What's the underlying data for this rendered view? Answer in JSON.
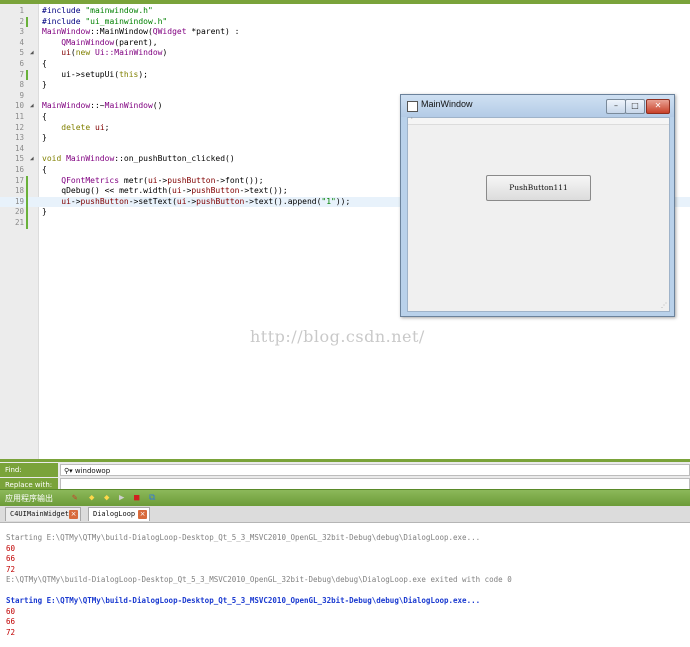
{
  "header": {
    "watermark_text": "http://blog.csdn.net/"
  },
  "editor": {
    "lines": [
      {
        "n": "1",
        "html": "<span class='pp'>#include</span> <span class='str'>\"mainwindow.h\"</span>"
      },
      {
        "n": "2",
        "html": "<span class='pp'>#include</span> <span class='str'>\"ui_mainwindow.h\"</span>",
        "mod": true
      },
      {
        "n": "3",
        "html": "<span class='cls'>MainWindow</span>::MainWindow(<span class='cls'>QWidget</span> *parent) :"
      },
      {
        "n": "4",
        "html": "    <span class='cls'>QMainWindow</span>(parent),"
      },
      {
        "n": "5",
        "html": "    <span class='mem'>ui</span>(<span class='kw'>new</span> <span class='cls'>Ui::MainWindow</span>)",
        "fold": true
      },
      {
        "n": "6",
        "html": "{"
      },
      {
        "n": "7",
        "html": "    ui-&gt;setupUi(<span class='kw'>this</span>);",
        "mod": true
      },
      {
        "n": "8",
        "html": "}"
      },
      {
        "n": "9",
        "html": ""
      },
      {
        "n": "10",
        "html": "<span class='cls'>MainWindow</span>::~<span class='cls'>MainWindow</span>()",
        "fold": true
      },
      {
        "n": "11",
        "html": "{"
      },
      {
        "n": "12",
        "html": "    <span class='kw'>delete</span> <span class='mem'>ui</span>;"
      },
      {
        "n": "13",
        "html": "}"
      },
      {
        "n": "14",
        "html": ""
      },
      {
        "n": "15",
        "html": "<span class='kw'>void</span> <span class='cls'>MainWindow</span>::on_pushButton_clicked()",
        "fold": true
      },
      {
        "n": "16",
        "html": "{"
      },
      {
        "n": "17",
        "html": "    <span class='cls'>QFontMetrics</span> metr(<span class='mem'>ui</span>-&gt;<span class='mem'>pushButton</span>-&gt;font());",
        "mod": true
      },
      {
        "n": "18",
        "html": "    qDebug() &lt;&lt; metr.width(<span class='mem'>ui</span>-&gt;<span class='mem'>pushButton</span>-&gt;text());",
        "mod": true
      },
      {
        "n": "19",
        "html": "    <span class='mem'>ui</span>-&gt;<span class='mem'>pushButton</span>-&gt;setText(<span class='mem'>ui</span>-&gt;<span class='mem'>pushButton</span>-&gt;text().append(<span class='str'>\"1\"</span>));",
        "mod": true,
        "hl": true
      },
      {
        "n": "20",
        "html": "}",
        "mod": true
      },
      {
        "n": "21",
        "html": "",
        "mod": true
      }
    ]
  },
  "main_window": {
    "title": "MainWindow",
    "minimize": "–",
    "maximize": "□",
    "close": "✕",
    "push_button": "PushButton111",
    "menubar_marker": "·"
  },
  "find": {
    "find_label": "Find:",
    "find_value": "windowop",
    "find_icon": "⚲▾",
    "replace_label": "Replace with:",
    "replace_value": ""
  },
  "output_pane": {
    "title": "应用程序输出",
    "tabs": [
      {
        "label": "C4UIMainWidget",
        "active": false
      },
      {
        "label": "DialogLoop",
        "active": true
      }
    ],
    "close_glyph": "×",
    "lines": [
      {
        "text": "Starting E:\\QTMy\\QTMy\\build-DialogLoop-Desktop_Qt_5_3_MSVC2010_OpenGL_32bit-Debug\\debug\\DialogLoop.exe...",
        "cls": "gray"
      },
      {
        "text": "60",
        "cls": "red"
      },
      {
        "text": "66",
        "cls": "red"
      },
      {
        "text": "72",
        "cls": "red"
      },
      {
        "text": "E:\\QTMy\\QTMy\\build-DialogLoop-Desktop_Qt_5_3_MSVC2010_OpenGL_32bit-Debug\\debug\\DialogLoop.exe exited with code 0",
        "cls": "gray"
      },
      {
        "text": "",
        "cls": "gray"
      },
      {
        "text": "Starting E:\\QTMy\\QTMy\\build-DialogLoop-Desktop_Qt_5_3_MSVC2010_OpenGL_32bit-Debug\\debug\\DialogLoop.exe...",
        "cls": "blue"
      },
      {
        "text": "60",
        "cls": "red"
      },
      {
        "text": "66",
        "cls": "red"
      },
      {
        "text": "72",
        "cls": "red"
      }
    ]
  }
}
